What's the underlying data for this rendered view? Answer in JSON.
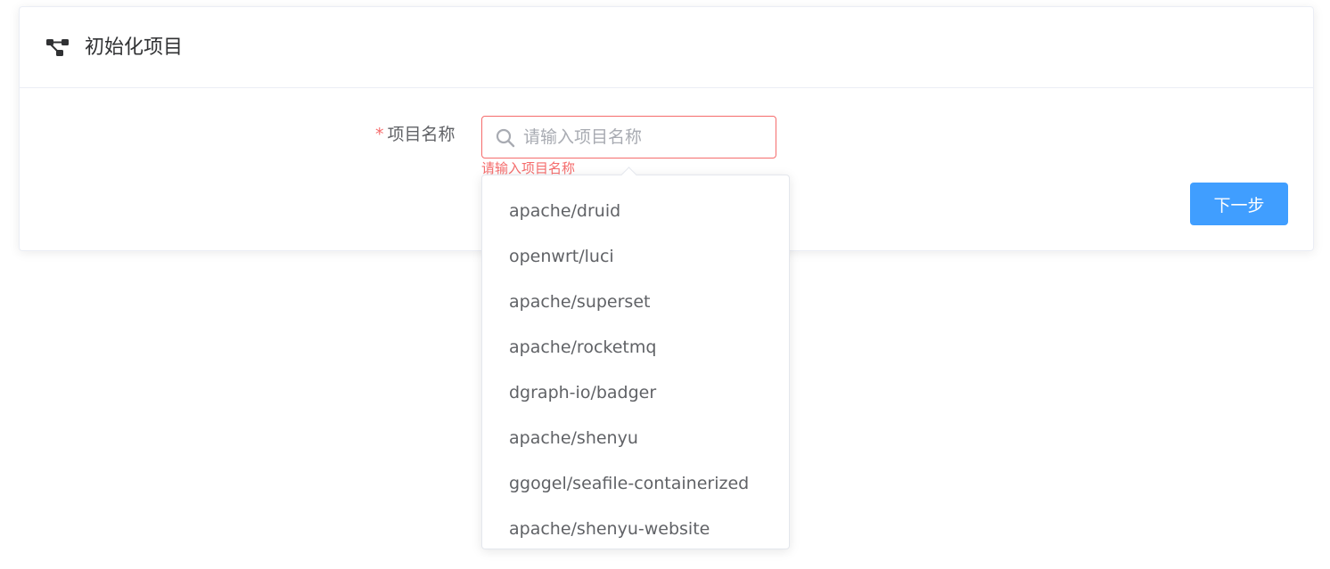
{
  "header": {
    "title": "初始化项目",
    "icon": "connection-icon"
  },
  "form": {
    "required_mark": "*",
    "label": "项目名称",
    "input": {
      "value": "",
      "placeholder": "请输入项目名称"
    },
    "error": "请输入项目名称"
  },
  "actions": {
    "next_label": "下一步"
  },
  "suggestions": [
    "apache/druid",
    "openwrt/luci",
    "apache/superset",
    "apache/rocketmq",
    "dgraph-io/badger",
    "apache/shenyu",
    "ggogel/seafile-containerized",
    "apache/shenyu-website"
  ],
  "colors": {
    "primary": "#409eff",
    "error": "#f56c6c",
    "text": "#606266",
    "title": "#303133"
  }
}
